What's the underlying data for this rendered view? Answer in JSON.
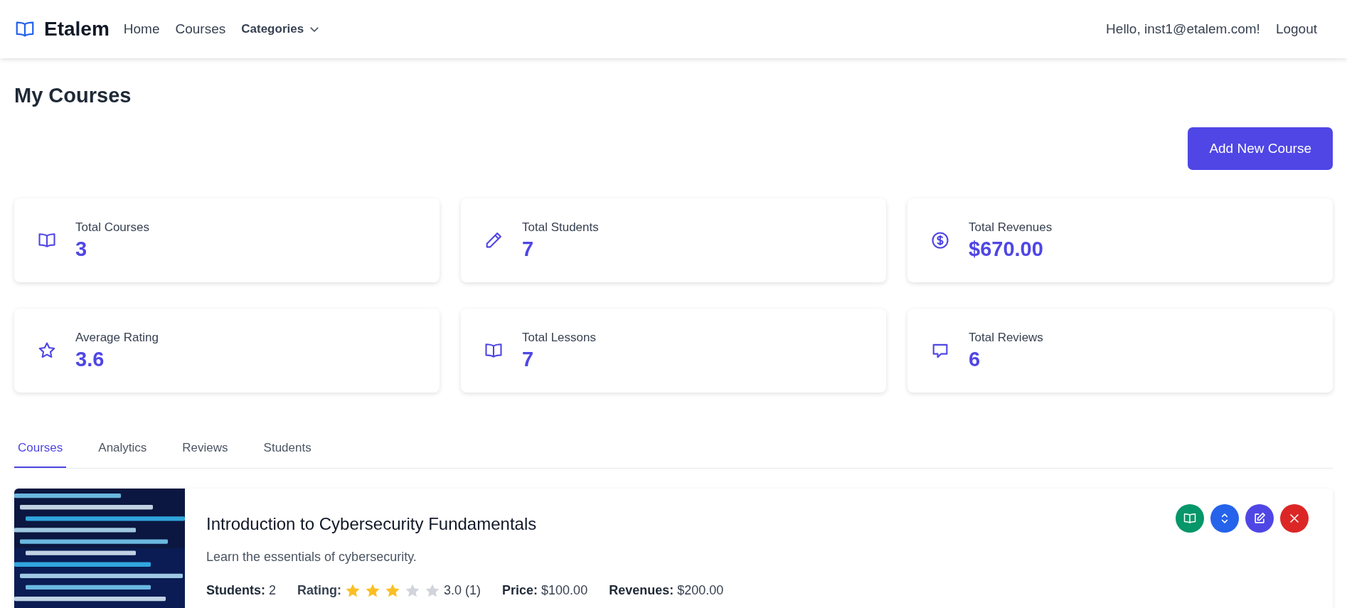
{
  "navbar": {
    "brand": "Etalem",
    "links": [
      {
        "label": "Home",
        "kind": "link"
      },
      {
        "label": "Courses",
        "kind": "link"
      },
      {
        "label": "Categories",
        "kind": "dropdown"
      }
    ],
    "greeting": "Hello, inst1@etalem.com!",
    "logout": "Logout"
  },
  "page_title": "My Courses",
  "add_button": "Add New Course",
  "stats": [
    {
      "kind": "book",
      "label": "Total Courses",
      "value": "3"
    },
    {
      "kind": "pencil",
      "label": "Total Students",
      "value": "7"
    },
    {
      "kind": "dollar",
      "label": "Total Revenues",
      "value": "$670.00"
    },
    {
      "kind": "star",
      "label": "Average Rating",
      "value": "3.6"
    },
    {
      "kind": "book",
      "label": "Total Lessons",
      "value": "7"
    },
    {
      "kind": "comment",
      "label": "Total Reviews",
      "value": "6"
    }
  ],
  "tabs": [
    {
      "label": "Courses",
      "selected": true
    },
    {
      "label": "Analytics",
      "selected": false
    },
    {
      "label": "Reviews",
      "selected": false
    },
    {
      "label": "Students",
      "selected": false
    }
  ],
  "courses": [
    {
      "kind": "picture",
      "title": "Introduction to Cybersecurity Fundamentals",
      "description": "Learn the essentials of cybersecurity.",
      "students": "**Students:** 2",
      "rating": {
        "label": "Rating:",
        "stars": 3,
        "reading": "3.0 (1)"
      },
      "price": "**Price:** $100.00",
      "revenues": "**Revenues:** $200.00",
      "actions": [
        {
          "kind": "book",
          "color": "#059669"
        },
        {
          "kind": "updown",
          "color": "#2563eb"
        },
        {
          "kind": "edit",
          "color": "#4f46e5"
        },
        {
          "kind": "close",
          "color": "#dc2626"
        }
      ]
    }
  ]
}
